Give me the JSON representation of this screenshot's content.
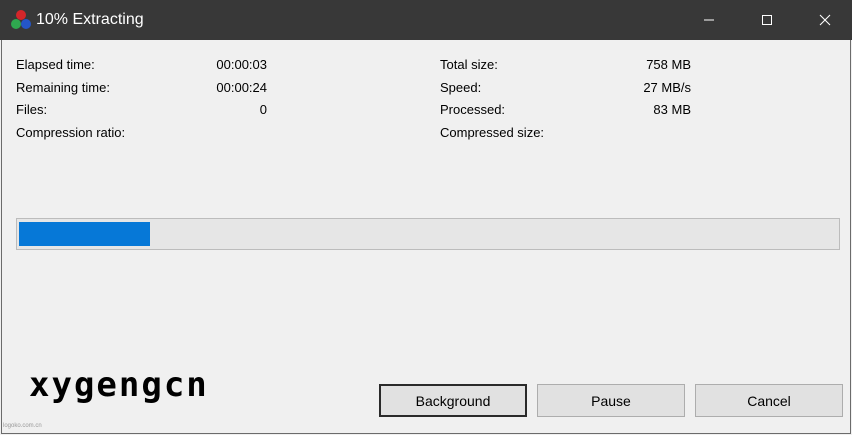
{
  "window": {
    "title": "10% Extracting",
    "accent_color": "#0678d7",
    "titlebar_color": "#383838",
    "controls": {
      "minimize_icon": "minimize-icon",
      "maximize_icon": "maximize-icon",
      "close_icon": "close-icon"
    }
  },
  "stats_left": [
    {
      "label": "Elapsed time:",
      "value": "00:00:03"
    },
    {
      "label": "Remaining time:",
      "value": "00:00:24"
    },
    {
      "label": "Files:",
      "value": "0"
    },
    {
      "label": "Compression ratio:",
      "value": ""
    }
  ],
  "stats_right": [
    {
      "label": "Total size:",
      "value": "758 MB"
    },
    {
      "label": "Speed:",
      "value": "27 MB/s"
    },
    {
      "label": "Processed:",
      "value": "83 MB"
    },
    {
      "label": "Compressed size:",
      "value": ""
    }
  ],
  "progress": {
    "percent": 10
  },
  "watermark": {
    "logo": "xygengcn",
    "small": "logoko.com.cn"
  },
  "buttons": {
    "background": "Background",
    "pause": "Pause",
    "cancel": "Cancel"
  }
}
